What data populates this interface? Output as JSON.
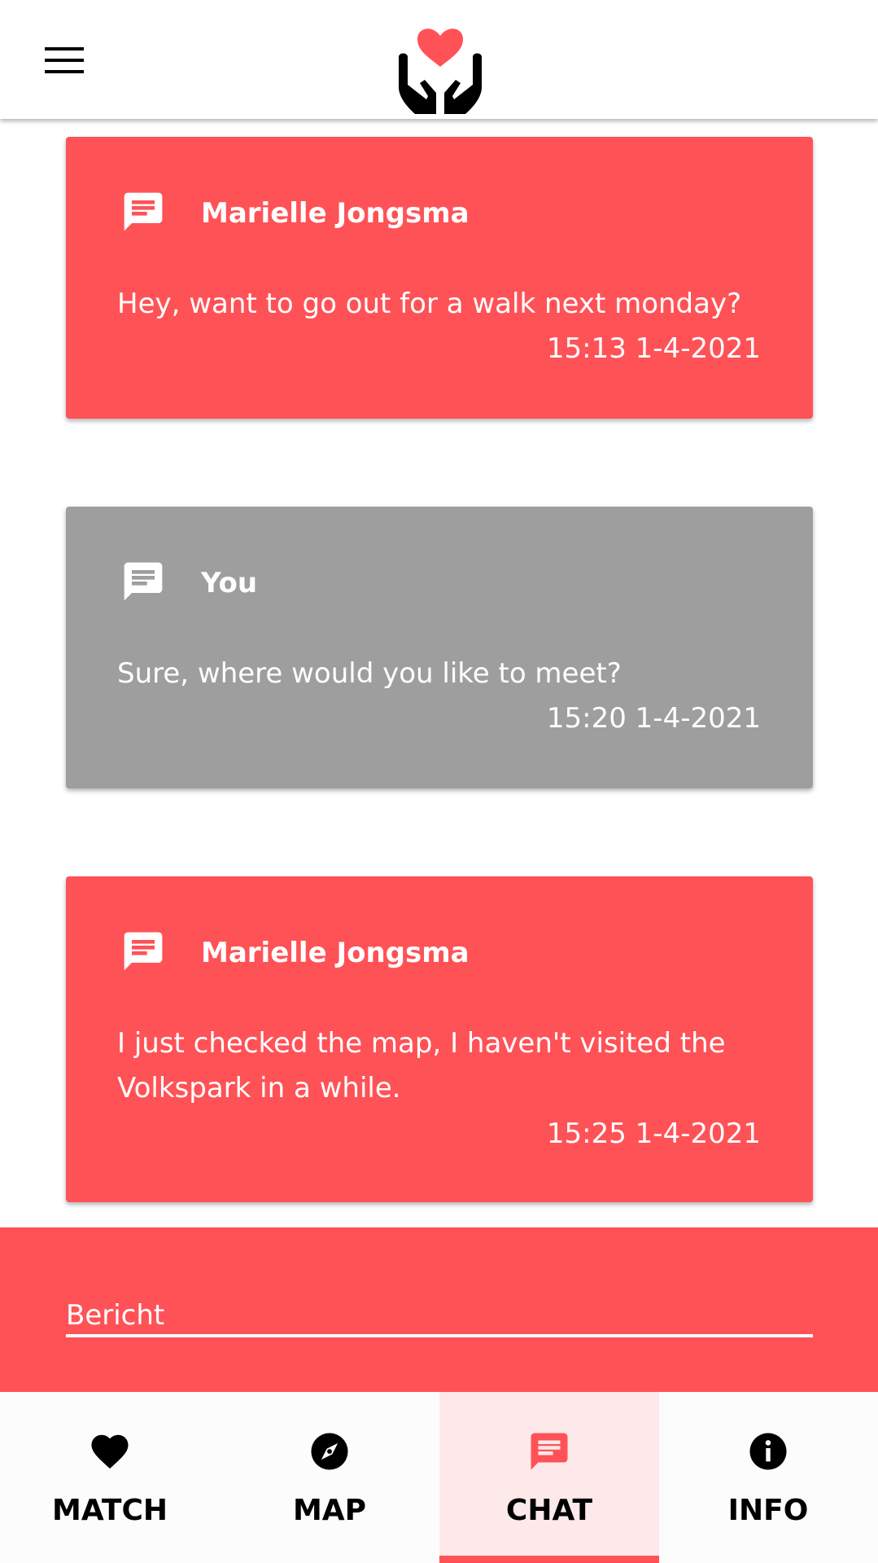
{
  "colors": {
    "accent": "#ff5257",
    "own_message": "#9e9e9e",
    "active_tab_bg": "#fde9e9",
    "text_on_accent": "#ffffff"
  },
  "header": {
    "menu_icon": "hamburger-menu-icon",
    "logo_icon": "heart-in-hands-logo"
  },
  "messages": [
    {
      "sender": "Marielle Jongsma",
      "text": "Hey, want to go out for a walk next monday?",
      "time": "15:13 1-4-2021",
      "icon": "chat-bubble-icon",
      "own": false
    },
    {
      "sender": "You",
      "text": "Sure, where would you like to meet?",
      "time": "15:20 1-4-2021",
      "icon": "chat-bubble-icon",
      "own": true
    },
    {
      "sender": "Marielle Jongsma",
      "text": "I just checked the map, I haven't visited the Volkspark in a while.",
      "time": "15:25 1-4-2021",
      "icon": "chat-bubble-icon",
      "own": false
    }
  ],
  "composer": {
    "placeholder": "Bericht",
    "value": ""
  },
  "bottom_nav": {
    "items": [
      {
        "label": "MATCH",
        "icon": "heart-icon",
        "active": false
      },
      {
        "label": "MAP",
        "icon": "compass-icon",
        "active": false
      },
      {
        "label": "CHAT",
        "icon": "chat-icon",
        "active": true
      },
      {
        "label": "INFO",
        "icon": "info-icon",
        "active": false
      }
    ]
  }
}
